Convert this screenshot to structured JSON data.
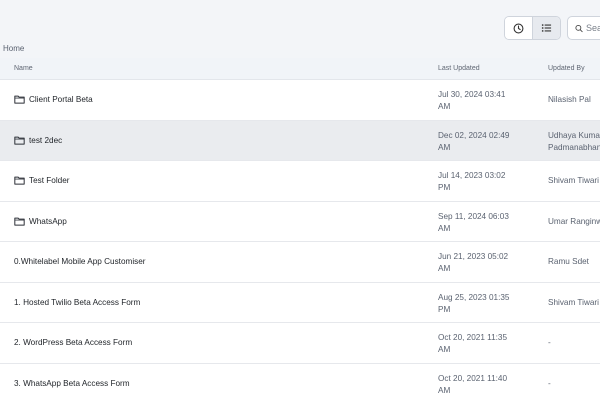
{
  "toolbar": {
    "recent_icon": "clock-icon",
    "list_icon": "list-view-icon",
    "search_placeholder": "Search"
  },
  "breadcrumb": "Home",
  "table": {
    "headers": {
      "name": "Name",
      "last_updated": "Last Updated",
      "updated_by": "Updated By"
    },
    "rows": [
      {
        "name": "Client Portal Beta",
        "folder": true,
        "date1": "Jul 30, 2024 03:41",
        "date2": "AM",
        "by1": "Nilasish Pal",
        "by2": ""
      },
      {
        "name": "test 2dec",
        "folder": true,
        "date1": "Dec 02, 2024 02:49",
        "date2": "AM",
        "by1": "Udhaya Kumar",
        "by2": "Padmanabhan"
      },
      {
        "name": "Test Folder",
        "folder": true,
        "date1": "Jul 14, 2023 03:02",
        "date2": "PM",
        "by1": "Shivam Tiwari",
        "by2": ""
      },
      {
        "name": "WhatsApp",
        "folder": true,
        "date1": "Sep 11, 2024 06:03",
        "date2": "AM",
        "by1": "Umar Ranginwala",
        "by2": ""
      },
      {
        "name": "0.Whitelabel Mobile App Customiser",
        "folder": false,
        "date1": "Jun 21, 2023 05:02",
        "date2": "AM",
        "by1": "Ramu Sdet",
        "by2": ""
      },
      {
        "name": "1. Hosted Twilio Beta Access Form",
        "folder": false,
        "date1": "Aug 25, 2023 01:35",
        "date2": "PM",
        "by1": "Shivam Tiwari",
        "by2": ""
      },
      {
        "name": "2. WordPress Beta Access Form",
        "folder": false,
        "date1": "Oct 20, 2021 11:35",
        "date2": "AM",
        "by1": "-",
        "by2": ""
      },
      {
        "name": "3. WhatsApp Beta Access Form",
        "folder": false,
        "date1": "Oct 20, 2021 11:40",
        "date2": "AM",
        "by1": "-",
        "by2": ""
      }
    ]
  },
  "colors": {
    "background": "#f3f5f8",
    "row_highlight": "#eaecef",
    "border": "#cfd4dc"
  }
}
